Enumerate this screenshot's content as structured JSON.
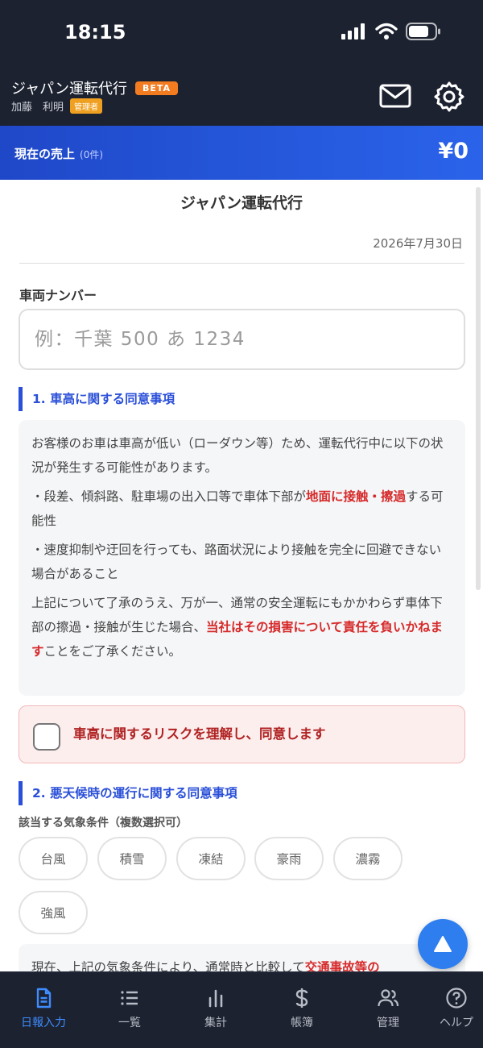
{
  "status_bar": {
    "time": "18:15"
  },
  "app_bar": {
    "title": "ジャパン運転代行",
    "beta_badge": "BETA",
    "user_name": "加藤　利明",
    "role_badge": "管理者",
    "icons": [
      "mail-icon",
      "gear-icon"
    ]
  },
  "sales_bar": {
    "label": "現在の売上",
    "count": "(0件)",
    "amount": "¥0"
  },
  "document": {
    "title": "ジャパン運転代行",
    "date": "2026年7月30日",
    "vehicle_label": "車両ナンバー",
    "vehicle_value": "",
    "vehicle_placeholder": "例：千葉 500 あ 1234"
  },
  "section1": {
    "heading": "1. 車高に関する同意事項",
    "p1": "お客様のお車は車高が低い（ローダウン等）ため、運転代行中に以下の状況が発生する可能性があります。",
    "p2_before": "・段差、傾斜路、駐車場の出入口等で車体下部が",
    "p2_red": "地面に接触・擦過",
    "p2_after": "する可能性",
    "p3": "・速度抑制や迂回を行っても、路面状況により接触を完全に回避できない場合があること",
    "p4_before": "上記について了承のうえ、万が一、通常の安全運転にもかかわらず車体下部の擦過・接触が生じた場合、",
    "p4_red": "当社はその損害について責任を負いかねます",
    "p4_after": "ことをご了承ください。",
    "agree_label": "車高に関するリスクを理解し、同意します",
    "agree_checked": false
  },
  "section2": {
    "heading": "2. 悪天候時の運行に関する同意事項",
    "weather_label": "該当する気象条件（複数選択可）",
    "chips": [
      "台風",
      "積雪",
      "凍結",
      "豪雨",
      "濃霧",
      "強風"
    ],
    "p1_before": "現在、上記の気象条件により、通常時と比較して",
    "p1_red": "交通事故等の"
  },
  "tab_bar": {
    "active_index": 0,
    "items": [
      {
        "label": "日報入力",
        "icon": "document-icon"
      },
      {
        "label": "一覧",
        "icon": "list-icon"
      },
      {
        "label": "集計",
        "icon": "bar-chart-icon"
      },
      {
        "label": "帳簿",
        "icon": "dollar-icon"
      },
      {
        "label": "管理",
        "icon": "users-icon"
      },
      {
        "label": "ヘルプ",
        "icon": "help-icon"
      }
    ]
  },
  "colors": {
    "header_bg": "#1c2230",
    "accent_blue": "#2a4fd8",
    "beta_orange": "#f47c20",
    "warning_red": "#d62a2a",
    "tab_active": "#3f8cff"
  }
}
